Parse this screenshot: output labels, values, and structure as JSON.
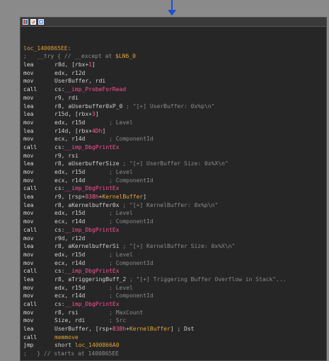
{
  "lines": [
    {
      "kind": "blank"
    },
    {
      "kind": "label",
      "text": "loc_1400865EE:"
    },
    {
      "kind": "try",
      "a": ";   __try { // __except at ",
      "b": "$LN6_0"
    },
    {
      "kind": "ins",
      "mn": "lea",
      "ops": [
        {
          "t": "r8d, [rbx+"
        },
        {
          "t": "1",
          "c": "num"
        },
        {
          "t": "]"
        }
      ]
    },
    {
      "kind": "ins",
      "mn": "mov",
      "ops": [
        {
          "t": "edx, r12d"
        }
      ]
    },
    {
      "kind": "ins",
      "mn": "mov",
      "ops": [
        {
          "t": "UserBuffer, rdi"
        }
      ]
    },
    {
      "kind": "ins",
      "mn": "call",
      "ops": [
        {
          "t": "cs:"
        },
        {
          "t": "__imp_ProbeForRead",
          "c": "imp"
        }
      ]
    },
    {
      "kind": "ins",
      "mn": "mov",
      "ops": [
        {
          "t": "r9, rdi"
        }
      ]
    },
    {
      "kind": "ins",
      "mn": "lea",
      "ops": [
        {
          "t": "r8, aUserbuffer0xP_0 "
        },
        {
          "t": "; \"[+] UserBuffer: 0x%p\\n\"",
          "c": "cm"
        }
      ]
    },
    {
      "kind": "ins",
      "mn": "lea",
      "ops": [
        {
          "t": "r15d, [rbx+"
        },
        {
          "t": "3",
          "c": "num"
        },
        {
          "t": "]"
        }
      ]
    },
    {
      "kind": "ins",
      "mn": "mov",
      "ops": [
        {
          "t": "edx, r15d       "
        },
        {
          "t": "; Level",
          "c": "cm"
        }
      ]
    },
    {
      "kind": "ins",
      "mn": "lea",
      "ops": [
        {
          "t": "r14d, [rbx+"
        },
        {
          "t": "4Dh",
          "c": "num"
        },
        {
          "t": "]"
        }
      ]
    },
    {
      "kind": "ins",
      "mn": "mov",
      "ops": [
        {
          "t": "ecx, r14d       "
        },
        {
          "t": "; ComponentId",
          "c": "cm"
        }
      ]
    },
    {
      "kind": "ins",
      "mn": "call",
      "ops": [
        {
          "t": "cs:"
        },
        {
          "t": "__imp_DbgPrintEx",
          "c": "imp"
        }
      ]
    },
    {
      "kind": "ins",
      "mn": "mov",
      "ops": [
        {
          "t": "r9, rsi"
        }
      ]
    },
    {
      "kind": "ins",
      "mn": "lea",
      "ops": [
        {
          "t": "r8, aUserbufferSize "
        },
        {
          "t": "; \"[+] UserBuffer Size: 0x%X\\n\"",
          "c": "cm"
        }
      ]
    },
    {
      "kind": "ins",
      "mn": "mov",
      "ops": [
        {
          "t": "edx, r15d       "
        },
        {
          "t": "; Level",
          "c": "cm"
        }
      ]
    },
    {
      "kind": "ins",
      "mn": "mov",
      "ops": [
        {
          "t": "ecx, r14d       "
        },
        {
          "t": "; ComponentId",
          "c": "cm"
        }
      ]
    },
    {
      "kind": "ins",
      "mn": "call",
      "ops": [
        {
          "t": "cs:"
        },
        {
          "t": "__imp_DbgPrintEx",
          "c": "imp"
        }
      ]
    },
    {
      "kind": "ins",
      "mn": "lea",
      "ops": [
        {
          "t": "r9, [rsp+"
        },
        {
          "t": "838h",
          "c": "num"
        },
        {
          "t": "+"
        },
        {
          "t": "KernelBuffer",
          "c": "sym"
        },
        {
          "t": "]"
        }
      ]
    },
    {
      "kind": "ins",
      "mn": "lea",
      "ops": [
        {
          "t": "r8, aKernelbuffer0x "
        },
        {
          "t": "; \"[+] KernelBuffer: 0x%p\\n\"",
          "c": "cm"
        }
      ]
    },
    {
      "kind": "ins",
      "mn": "mov",
      "ops": [
        {
          "t": "edx, r15d       "
        },
        {
          "t": "; Level",
          "c": "cm"
        }
      ]
    },
    {
      "kind": "ins",
      "mn": "mov",
      "ops": [
        {
          "t": "ecx, r14d       "
        },
        {
          "t": "; ComponentId",
          "c": "cm"
        }
      ]
    },
    {
      "kind": "ins",
      "mn": "call",
      "ops": [
        {
          "t": "cs:"
        },
        {
          "t": "__imp_DbgPrintEx",
          "c": "imp"
        }
      ]
    },
    {
      "kind": "ins",
      "mn": "mov",
      "ops": [
        {
          "t": "r9d, r12d"
        }
      ]
    },
    {
      "kind": "ins",
      "mn": "lea",
      "ops": [
        {
          "t": "r8, aKernelbufferSi "
        },
        {
          "t": "; \"[+] KernelBuffer Size: 0x%X\\n\"",
          "c": "cm"
        }
      ]
    },
    {
      "kind": "ins",
      "mn": "mov",
      "ops": [
        {
          "t": "edx, r15d       "
        },
        {
          "t": "; Level",
          "c": "cm"
        }
      ]
    },
    {
      "kind": "ins",
      "mn": "mov",
      "ops": [
        {
          "t": "ecx, r14d       "
        },
        {
          "t": "; ComponentId",
          "c": "cm"
        }
      ]
    },
    {
      "kind": "ins",
      "mn": "call",
      "ops": [
        {
          "t": "cs:"
        },
        {
          "t": "__imp_DbgPrintEx",
          "c": "imp"
        }
      ]
    },
    {
      "kind": "ins",
      "mn": "lea",
      "ops": [
        {
          "t": "r8, aTriggeringBuff_2 "
        },
        {
          "t": "; \"[+] Triggering Buffer Overflow in Stack\"...",
          "c": "cm"
        }
      ]
    },
    {
      "kind": "ins",
      "mn": "mov",
      "ops": [
        {
          "t": "edx, r15d       "
        },
        {
          "t": "; Level",
          "c": "cm"
        }
      ]
    },
    {
      "kind": "ins",
      "mn": "mov",
      "ops": [
        {
          "t": "ecx, r14d       "
        },
        {
          "t": "; ComponentId",
          "c": "cm"
        }
      ]
    },
    {
      "kind": "ins",
      "mn": "call",
      "ops": [
        {
          "t": "cs:"
        },
        {
          "t": "__imp_DbgPrintEx",
          "c": "imp"
        }
      ]
    },
    {
      "kind": "ins",
      "mn": "mov",
      "ops": [
        {
          "t": "r8, rsi         "
        },
        {
          "t": "; MaxCount",
          "c": "cm"
        }
      ]
    },
    {
      "kind": "ins",
      "mn": "mov",
      "ops": [
        {
          "t": "Size, rdi       "
        },
        {
          "t": "; Src",
          "c": "cm"
        }
      ]
    },
    {
      "kind": "ins",
      "mn": "lea",
      "ops": [
        {
          "t": "UserBuffer, [rsp+"
        },
        {
          "t": "838h",
          "c": "num"
        },
        {
          "t": "+"
        },
        {
          "t": "KernelBuffer",
          "c": "sym"
        },
        {
          "t": "] ; Dst"
        }
      ]
    },
    {
      "kind": "ins",
      "mn": "call",
      "ops": [
        {
          "t": "memmove",
          "c": "sym"
        }
      ]
    },
    {
      "kind": "ins",
      "mn": "jmp",
      "ops": [
        {
          "t": "short "
        },
        {
          "t": "loc_1400866A0",
          "c": "sym"
        }
      ]
    },
    {
      "kind": "end",
      "text": ";   } // starts at 1400865EE"
    }
  ],
  "icons": [
    "color-icon",
    "edit-icon",
    "graph-icon"
  ]
}
